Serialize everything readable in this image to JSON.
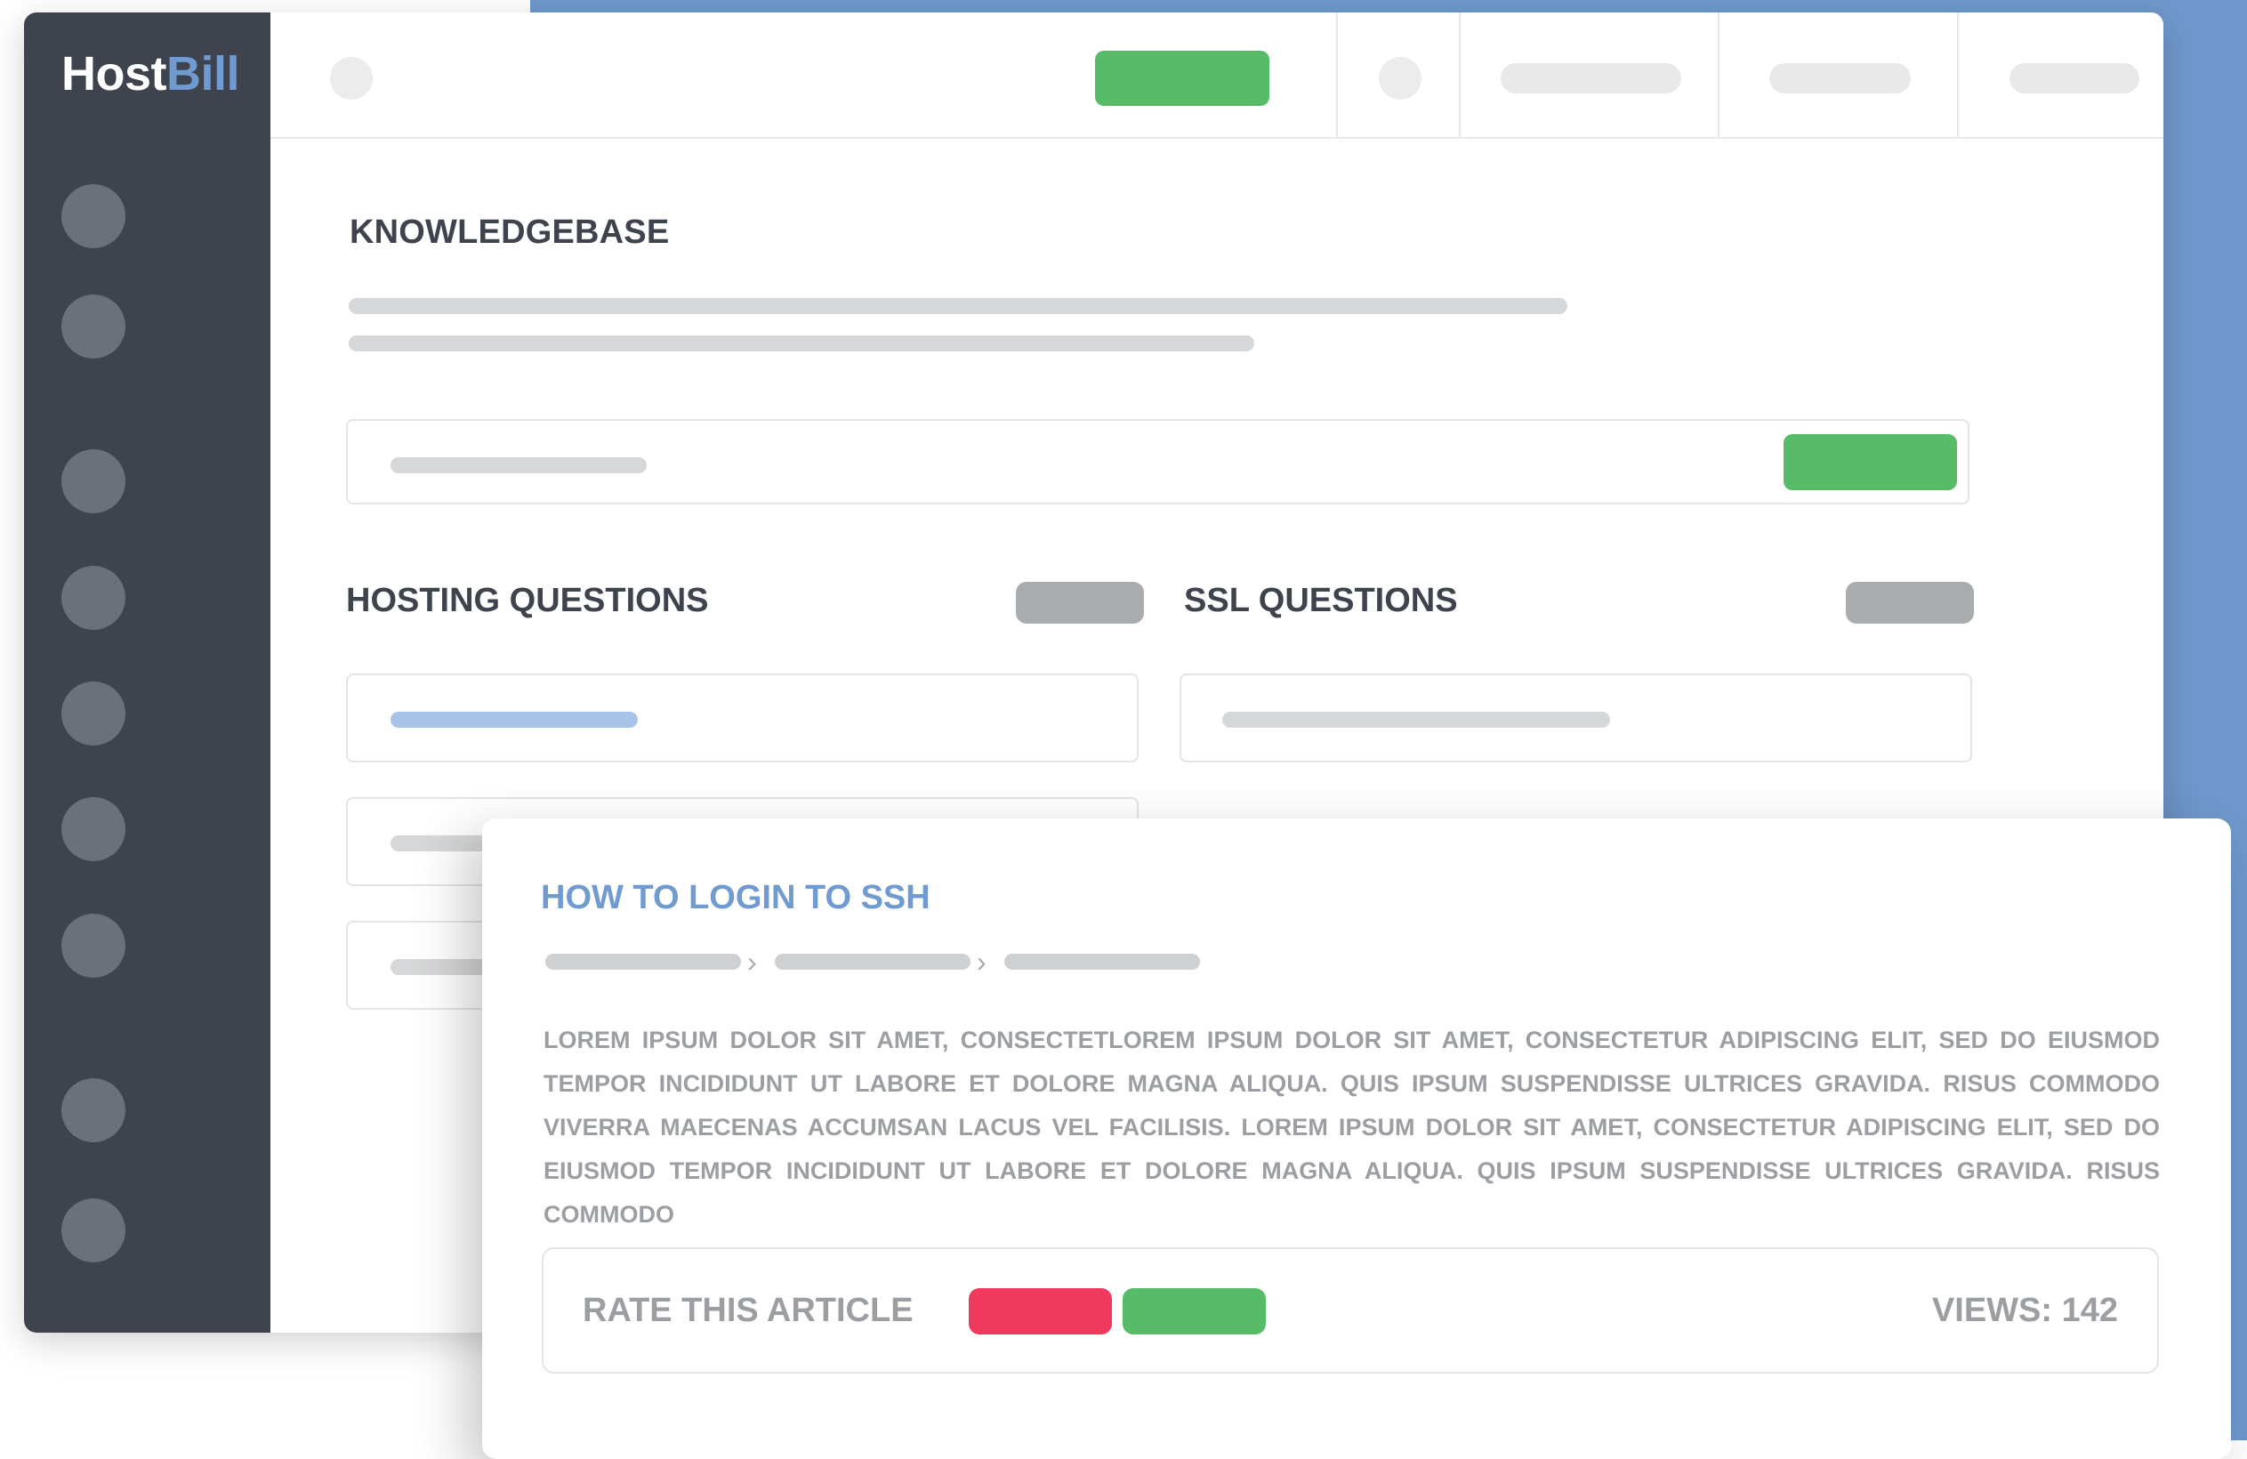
{
  "brand": {
    "logo_part1": "Host",
    "logo_part2": "Bill"
  },
  "knowledgebase": {
    "title": "KNOWLEDGEBASE"
  },
  "sections": [
    {
      "title": "HOSTING QUESTIONS"
    },
    {
      "title": "SSL QUESTIONS"
    }
  ],
  "article": {
    "title": "HOW TO LOGIN TO SSH",
    "body": "LOREM IPSUM DOLOR SIT AMET, CONSECTETLOREM IPSUM DOLOR SIT AMET, CONSECTETUR ADIPISCING ELIT, SED DO EIUSMOD TEMPOR INCIDIDUNT UT LABORE ET DOLORE MAGNA ALIQUA. QUIS IPSUM SUSPENDISSE ULTRICES GRAVIDA. RISUS COMMODO VIVERRA MAECENAS ACCUMSAN LACUS VEL FACILISIS. LOREM IPSUM DOLOR SIT AMET, CONSECTETUR ADIPISCING ELIT, SED DO EIUSMOD TEMPOR INCIDIDUNT UT LABORE ET DOLORE MAGNA ALIQUA. QUIS IPSUM SUSPENDISSE ULTRICES GRAVIDA. RISUS COMMODO",
    "rate_label": "RATE THIS ARTICLE",
    "views": "VIEWS: 142"
  },
  "colors": {
    "sidebar": "#3e434d",
    "accent_blue": "#6f9bd1",
    "green": "#58bb68",
    "red": "#ef3a5d",
    "background_blue": "#6f98cc"
  },
  "icons": {
    "breadcrumb_separator": "chevron-right-icon"
  }
}
